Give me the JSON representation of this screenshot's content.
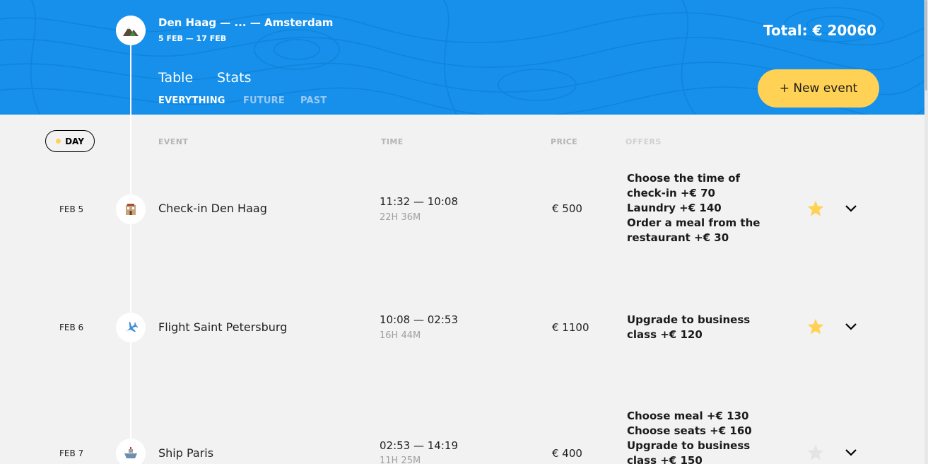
{
  "trip": {
    "title": "Den Haag — ... — Amsterdam",
    "dates": "5 FEB — 17 FEB",
    "icon": "mountain-icon"
  },
  "total": "Total: € 20060",
  "views": [
    "Table",
    "Stats"
  ],
  "filters": [
    "EVERYTHING",
    "FUTURE",
    "PAST"
  ],
  "active_filter": "EVERYTHING",
  "new_event_label": "+ New event",
  "columns": {
    "day": "DAY",
    "event": "EVENT",
    "time": "TIME",
    "price": "PRICE",
    "offers": "OFFERS"
  },
  "events": [
    {
      "date": "FEB 5",
      "icon": "hotel-icon",
      "name": "Check-in Den Haag",
      "time": "11:32 — 10:08",
      "duration": "22H 36M",
      "price": "€ 500",
      "offers": [
        "Choose the time of check-in +€  70",
        "Laundry +€  140",
        "Order a meal from the restaurant +€  30"
      ],
      "favorite": true
    },
    {
      "date": "FEB 6",
      "icon": "airplane-icon",
      "name": "Flight Saint Petersburg",
      "time": "10:08 — 02:53",
      "duration": "16H 44M",
      "price": "€ 1100",
      "offers": [
        "Upgrade to business class +€  120"
      ],
      "favorite": true
    },
    {
      "date": "FEB 7",
      "icon": "ship-icon",
      "name": "Ship Paris",
      "time": "02:53 — 14:19",
      "duration": "11H 25M",
      "price": "€ 400",
      "offers": [
        "Choose meal +€  130",
        "Choose seats +€  160",
        "Upgrade to business class +€  150"
      ],
      "favorite": false
    }
  ],
  "colors": {
    "header_blue": "#1690eb",
    "accent_yellow": "#ffd154",
    "background": "#f2f2f2"
  }
}
